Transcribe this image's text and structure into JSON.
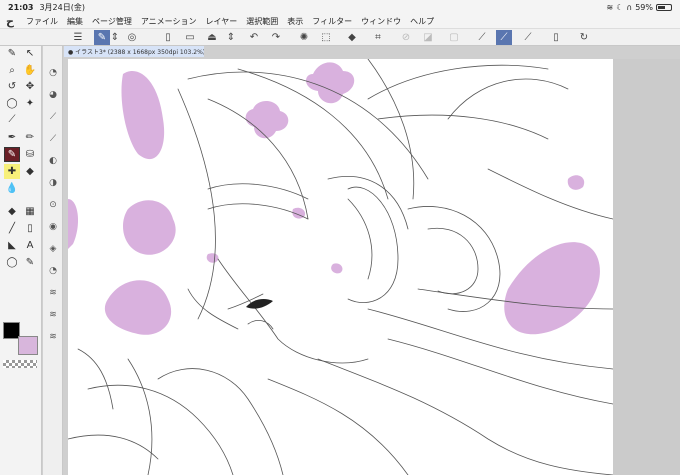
{
  "status": {
    "time": "21:03",
    "date": "3月24日(金)",
    "battery": "59%",
    "battery_level": 0.59
  },
  "menu": [
    "ファイル",
    "編集",
    "ページ管理",
    "アニメーション",
    "レイヤー",
    "選択範囲",
    "表示",
    "フィルター",
    "ウィンドウ",
    "ヘルプ"
  ],
  "document": {
    "tab_label": "● イラスト3* (2388 x 1668px 350dpi 103.2%)"
  },
  "colors": {
    "main": "#000000",
    "sub": "#d8b6dc",
    "accent": "#5a76b0",
    "sketch_pink": "#d9b1de"
  }
}
